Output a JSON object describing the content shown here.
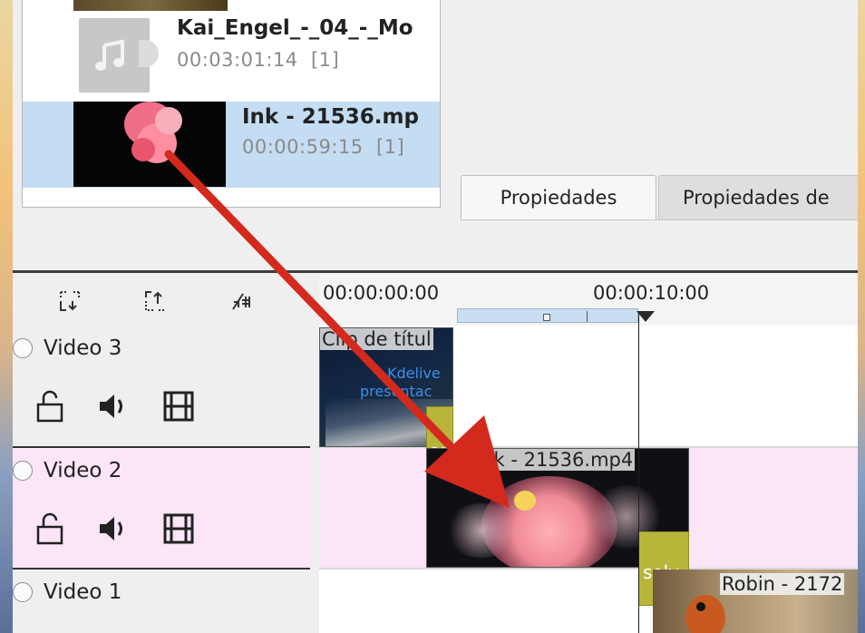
{
  "bin": {
    "items": [
      {
        "name": "Kai_Engel_-_04_-_Mo",
        "duration": "00:03:01:14",
        "count": "[1]",
        "selected": false
      },
      {
        "name": "Ink - 21536.mp",
        "duration": "00:00:59:15",
        "count": "[1]",
        "selected": true
      }
    ]
  },
  "tabs": [
    {
      "label": "Propiedades",
      "active": true
    },
    {
      "label": "Propiedades de",
      "active": false
    }
  ],
  "timeline": {
    "toolbar_icons": [
      "insert-zone-icon",
      "extract-zone-icon",
      "snap-icon"
    ],
    "ruler": {
      "labels": [
        "00:00:00:00",
        "00:00:10:00"
      ]
    },
    "tracks": [
      {
        "name": "Video 3",
        "lane_color": "#ffffff"
      },
      {
        "name": "Video 2",
        "lane_color": "#fbe5f6"
      },
      {
        "name": "Video 1",
        "lane_color": "#ffffff"
      }
    ],
    "clips": {
      "title_clip": {
        "label": "Clip de títul",
        "text1": "Kdelive",
        "text2": "presentac"
      },
      "ink_clip": {
        "label": "Ink - 21536.mp4"
      },
      "robin_clip": {
        "label": "Robin - 2172"
      },
      "transition_1": {
        "label": "or"
      },
      "transition_2": {
        "label": "solv"
      }
    }
  },
  "colors": {
    "selection": "#c4ddf3",
    "arrow": "#d42a1e",
    "transition": "#b8b53a",
    "video2_lane": "#fbe5f6"
  }
}
